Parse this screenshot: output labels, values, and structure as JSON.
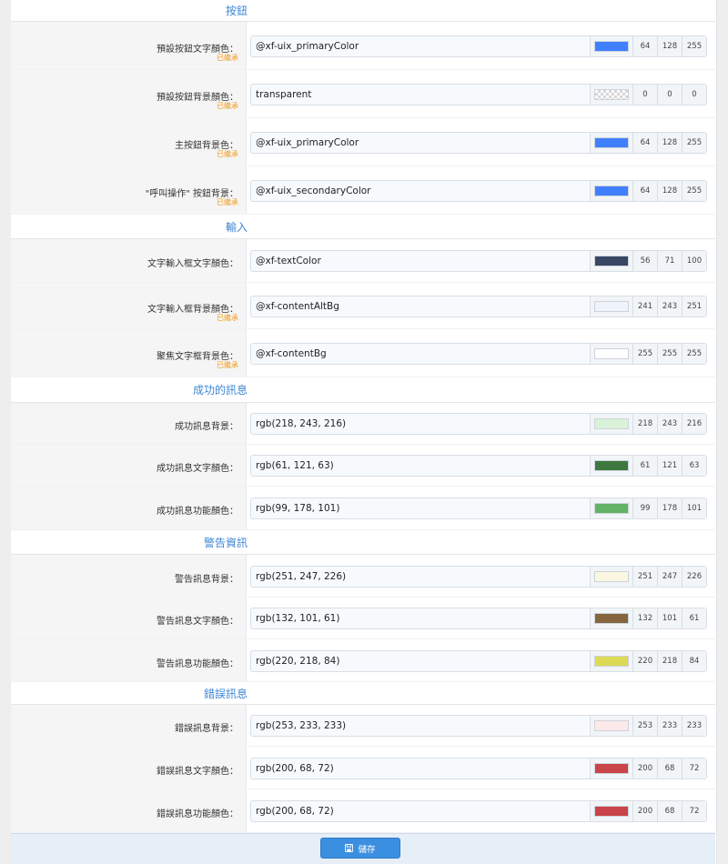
{
  "inherited_label": "已繼承",
  "save_label": "儲存",
  "sections": [
    {
      "title": "按鈕",
      "fields": [
        {
          "label": "預設按鈕文字顏色：",
          "inherited": true,
          "value": "@xf-uix_primaryColor",
          "color": "#4080ff",
          "rgb": [
            "64",
            "128",
            "255"
          ]
        },
        {
          "label": "預設按鈕背景顏色：",
          "inherited": true,
          "value": "transparent",
          "color": "transparent",
          "rgb": [
            "0",
            "0",
            "0"
          ]
        },
        {
          "label": "主按鈕背景色：",
          "inherited": true,
          "value": "@xf-uix_primaryColor",
          "color": "#4080ff",
          "rgb": [
            "64",
            "128",
            "255"
          ]
        },
        {
          "label": "\"呼叫操作\" 按鈕背景：",
          "inherited": true,
          "value": "@xf-uix_secondaryColor",
          "color": "#4080ff",
          "rgb": [
            "64",
            "128",
            "255"
          ]
        }
      ]
    },
    {
      "title": "輸入",
      "fields": [
        {
          "label": "文字輸入框文字顏色：",
          "inherited": false,
          "value": "@xf-textColor",
          "color": "#384764",
          "rgb": [
            "56",
            "71",
            "100"
          ]
        },
        {
          "label": "文字輸入框背景顏色：",
          "inherited": true,
          "value": "@xf-contentAltBg",
          "color": "#f1f3fb",
          "rgb": [
            "241",
            "243",
            "251"
          ]
        },
        {
          "label": "聚焦文字框背景色：",
          "inherited": true,
          "value": "@xf-contentBg",
          "color": "#ffffff",
          "rgb": [
            "255",
            "255",
            "255"
          ]
        }
      ]
    },
    {
      "title": "成功的訊息",
      "fields": [
        {
          "label": "成功訊息背景：",
          "inherited": false,
          "value": "rgb(218, 243, 216)",
          "color": "#daf3d8",
          "rgb": [
            "218",
            "243",
            "216"
          ]
        },
        {
          "label": "成功訊息文字顏色：",
          "inherited": false,
          "value": "rgb(61, 121, 63)",
          "color": "#3d793f",
          "rgb": [
            "61",
            "121",
            "63"
          ]
        },
        {
          "label": "成功訊息功能顏色：",
          "inherited": false,
          "value": "rgb(99, 178, 101)",
          "color": "#63b265",
          "rgb": [
            "99",
            "178",
            "101"
          ]
        }
      ]
    },
    {
      "title": "警告資訊",
      "fields": [
        {
          "label": "警告訊息背景：",
          "inherited": false,
          "value": "rgb(251, 247, 226)",
          "color": "#fbf7e2",
          "rgb": [
            "251",
            "247",
            "226"
          ]
        },
        {
          "label": "警告訊息文字顏色：",
          "inherited": false,
          "value": "rgb(132, 101, 61)",
          "color": "#84653d",
          "rgb": [
            "132",
            "101",
            "61"
          ]
        },
        {
          "label": "警告訊息功能顏色：",
          "inherited": false,
          "value": "rgb(220, 218, 84)",
          "color": "#dcda54",
          "rgb": [
            "220",
            "218",
            "84"
          ]
        }
      ]
    },
    {
      "title": "錯誤訊息",
      "fields": [
        {
          "label": "錯誤訊息背景：",
          "inherited": false,
          "value": "rgb(253, 233, 233)",
          "color": "#fde9e9",
          "rgb": [
            "253",
            "233",
            "233"
          ]
        },
        {
          "label": "錯誤訊息文字顏色：",
          "inherited": false,
          "value": "rgb(200, 68, 72)",
          "color": "#c84448",
          "rgb": [
            "200",
            "68",
            "72"
          ]
        },
        {
          "label": "錯誤訊息功能顏色：",
          "inherited": false,
          "value": "rgb(200, 68, 72)",
          "color": "#c84448",
          "rgb": [
            "200",
            "68",
            "72"
          ]
        }
      ]
    }
  ]
}
